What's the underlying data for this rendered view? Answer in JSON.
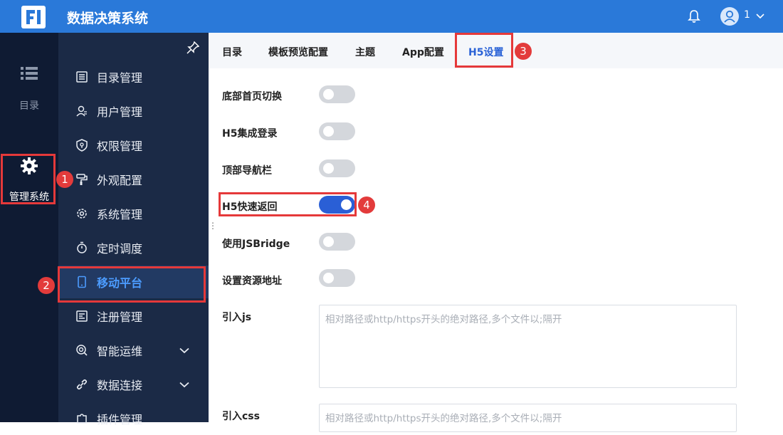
{
  "header": {
    "app_title": "数据决策系统",
    "user_name": "1"
  },
  "rail": {
    "items": [
      {
        "label": "目录"
      },
      {
        "label": "管理系统"
      }
    ]
  },
  "sidebar": {
    "items": [
      {
        "label": "目录管理"
      },
      {
        "label": "用户管理"
      },
      {
        "label": "权限管理"
      },
      {
        "label": "外观配置"
      },
      {
        "label": "系统管理"
      },
      {
        "label": "定时调度"
      },
      {
        "label": "移动平台"
      },
      {
        "label": "注册管理"
      },
      {
        "label": "智能运维"
      },
      {
        "label": "数据连接"
      },
      {
        "label": "插件管理"
      }
    ]
  },
  "tabs": [
    {
      "label": "目录"
    },
    {
      "label": "模板预览配置"
    },
    {
      "label": "主题"
    },
    {
      "label": "App配置"
    },
    {
      "label": "H5设置"
    }
  ],
  "settings": [
    {
      "label": "底部首页切换",
      "on": false
    },
    {
      "label": "H5集成登录",
      "on": false
    },
    {
      "label": "顶部导航栏",
      "on": false
    },
    {
      "label": "H5快速返回",
      "on": true
    },
    {
      "label": "使用JSBridge",
      "on": false
    },
    {
      "label": "设置资源地址",
      "on": false
    }
  ],
  "inputs": {
    "js": {
      "label": "引入js",
      "placeholder": "相对路径或http/https开头的绝对路径,多个文件以;隔开",
      "value": ""
    },
    "css": {
      "label": "引入css",
      "placeholder": "相对路径或http/https开头的绝对路径,多个文件以;隔开",
      "value": ""
    }
  },
  "annotations": [
    "1",
    "2",
    "3",
    "4"
  ],
  "colors": {
    "header": "#2a79d9",
    "rail": "#0f1b33",
    "sidebar": "#1b2a46",
    "active_tab": "#2a62d6",
    "toggle_on": "#2a5fd6",
    "highlight": "#e5393a"
  }
}
